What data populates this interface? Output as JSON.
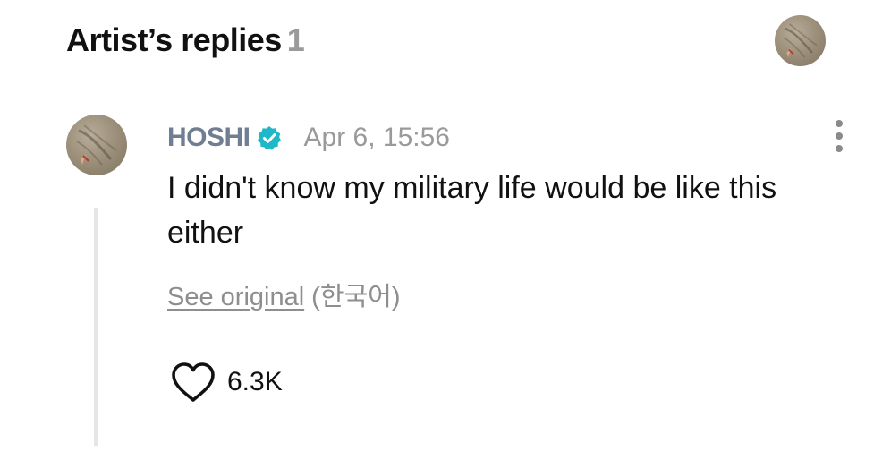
{
  "header": {
    "title": "Artist’s replies",
    "count": "1"
  },
  "comment": {
    "author": "HOSHI",
    "verified": true,
    "timestamp": "Apr 6, 15:56",
    "text": "I didn't know my military life would be like this either",
    "see_original_label": "See original",
    "original_language": "(한국어)",
    "like_count": "6.3K",
    "icons": {
      "verified": "verified-badge-icon",
      "more": "more-vertical-icon",
      "like": "heart-outline-icon"
    }
  },
  "colors": {
    "author": "#6f7e90",
    "verified_badge": "#1fb8c8",
    "muted": "#9a9a9a",
    "thread_line": "#e6e6e6"
  }
}
